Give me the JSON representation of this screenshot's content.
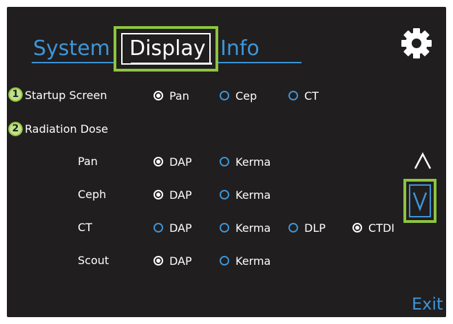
{
  "tabs": {
    "system_label": "System",
    "display_label": "Display",
    "info_label": "Info"
  },
  "icons": {
    "settings": "gear-icon",
    "scroll_up": "chevron-up-icon",
    "scroll_down": "chevron-down-icon"
  },
  "badges": {
    "first": "1",
    "second": "2"
  },
  "startup_screen": {
    "label": "Startup Screen",
    "options": [
      {
        "label": "Pan",
        "selected": true
      },
      {
        "label": "Cep",
        "selected": false
      },
      {
        "label": "CT",
        "selected": false
      }
    ]
  },
  "radiation_dose": {
    "label": "Radiation Dose",
    "rows": [
      {
        "label": "Pan",
        "options": [
          {
            "label": "DAP",
            "selected": true
          },
          {
            "label": "Kerma",
            "selected": false
          }
        ]
      },
      {
        "label": "Ceph",
        "options": [
          {
            "label": "DAP",
            "selected": true
          },
          {
            "label": "Kerma",
            "selected": false
          }
        ]
      },
      {
        "label": "CT",
        "options": [
          {
            "label": "DAP",
            "selected": false
          },
          {
            "label": "Kerma",
            "selected": false
          },
          {
            "label": "DLP",
            "selected": false
          },
          {
            "label": "CTDI",
            "selected": true
          }
        ]
      },
      {
        "label": "Scout",
        "options": [
          {
            "label": "DAP",
            "selected": true
          },
          {
            "label": "Kerma",
            "selected": false
          }
        ]
      }
    ]
  },
  "exit_label": "Exit",
  "colors": {
    "background": "#211e1f",
    "accent_blue": "#3d95d8",
    "highlight_green": "#8dc63f",
    "text": "#ffffff"
  }
}
